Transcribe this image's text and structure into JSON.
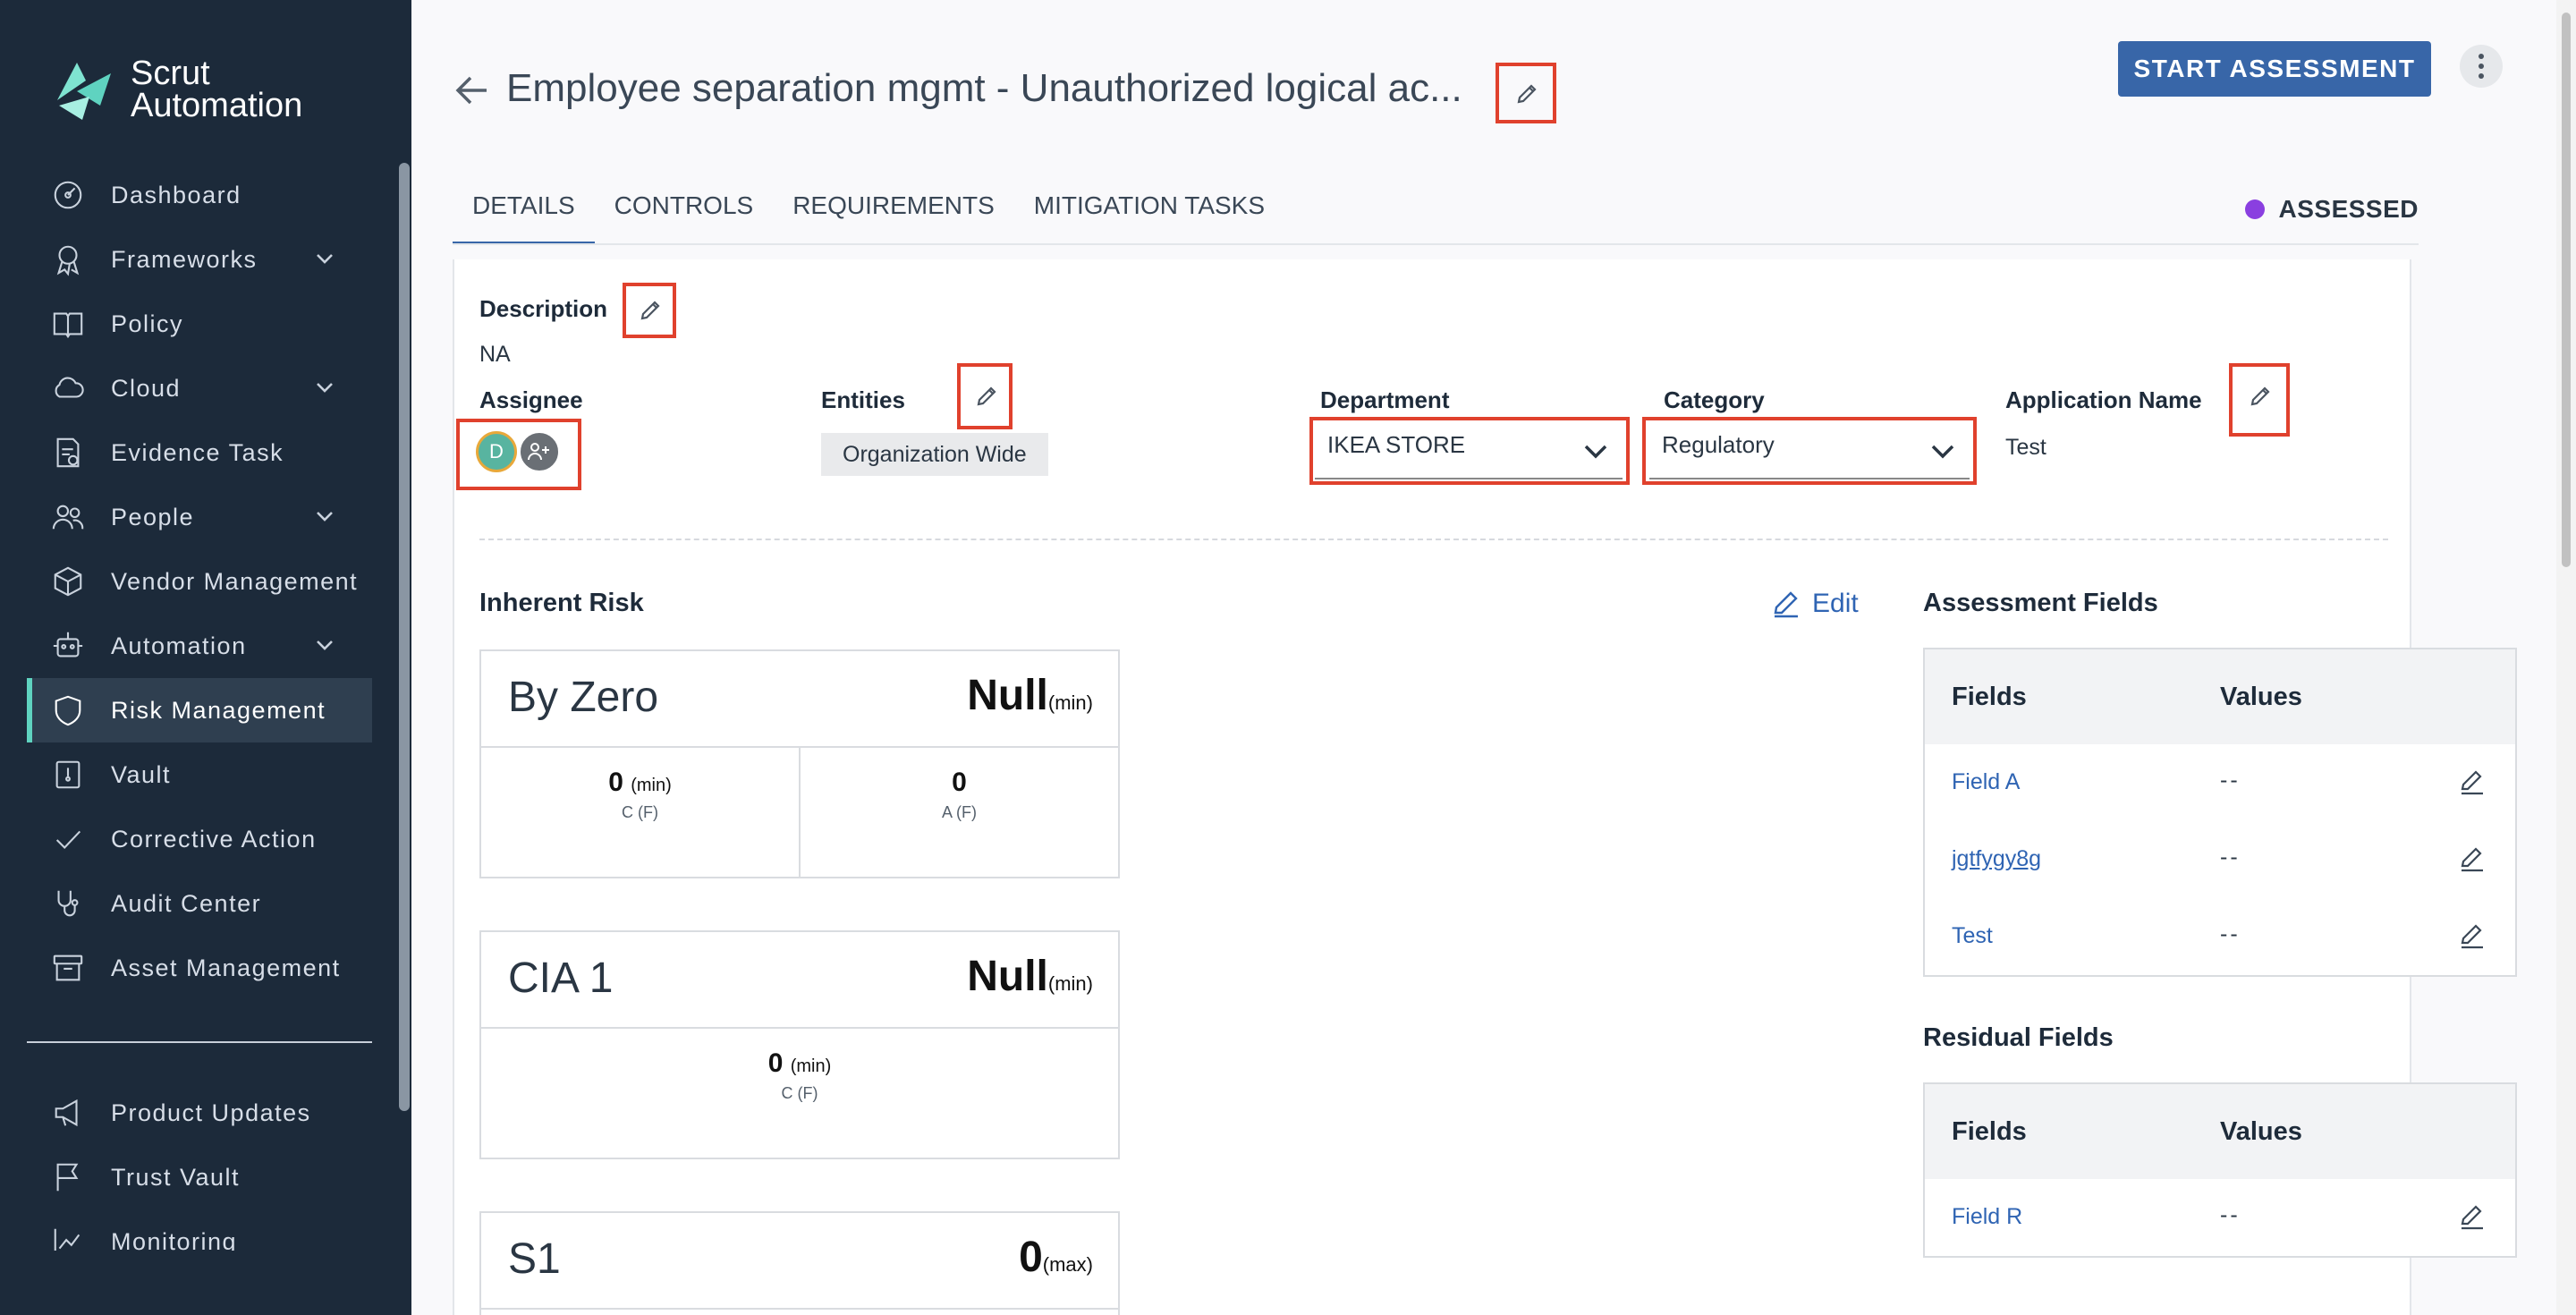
{
  "brand": {
    "line1": "Scrut",
    "line2": "Automation",
    "accent": "#5fd3c0"
  },
  "sidebar": {
    "items": [
      {
        "label": "Dashboard",
        "icon": "dashboard-icon",
        "expandable": false
      },
      {
        "label": "Frameworks",
        "icon": "award-icon",
        "expandable": true
      },
      {
        "label": "Policy",
        "icon": "book-icon",
        "expandable": false
      },
      {
        "label": "Cloud",
        "icon": "cloud-icon",
        "expandable": true
      },
      {
        "label": "Evidence Task",
        "icon": "evidence-icon",
        "expandable": false
      },
      {
        "label": "People",
        "icon": "people-icon",
        "expandable": true
      },
      {
        "label": "Vendor Management",
        "icon": "box-icon",
        "expandable": false
      },
      {
        "label": "Automation",
        "icon": "robot-icon",
        "expandable": true
      },
      {
        "label": "Risk Management",
        "icon": "shield-icon",
        "expandable": false,
        "active": true
      },
      {
        "label": "Vault",
        "icon": "vault-icon",
        "expandable": false
      },
      {
        "label": "Corrective Action",
        "icon": "check-icon",
        "expandable": false
      },
      {
        "label": "Audit Center",
        "icon": "stethoscope-icon",
        "expandable": false
      },
      {
        "label": "Asset Management",
        "icon": "archive-icon",
        "expandable": false
      }
    ],
    "bottom_items": [
      {
        "label": "Product Updates",
        "icon": "megaphone-icon"
      },
      {
        "label": "Trust Vault",
        "icon": "flag-icon"
      },
      {
        "label": "Monitoring",
        "icon": "chart-icon"
      }
    ]
  },
  "header": {
    "title": "Employee separation mgmt - Unauthorized logical ac...",
    "start_label": "START ASSESSMENT",
    "start_color": "#3866a8"
  },
  "tabs": [
    {
      "label": "DETAILS",
      "active": true
    },
    {
      "label": "CONTROLS"
    },
    {
      "label": "REQUIREMENTS"
    },
    {
      "label": "MITIGATION TASKS"
    }
  ],
  "status": {
    "label": "ASSESSED",
    "color": "#8a3fe0"
  },
  "details": {
    "description_label": "Description",
    "description_value": "NA",
    "assignee_label": "Assignee",
    "assignee_initial": "D",
    "entities_label": "Entities",
    "entities_chip": "Organization Wide",
    "department_label": "Department",
    "department_value": "IKEA STORE",
    "category_label": "Category",
    "category_value": "Regulatory",
    "appname_label": "Application Name",
    "appname_value": "Test"
  },
  "inherent": {
    "title": "Inherent Risk",
    "edit_label": "Edit",
    "boxes": [
      {
        "name": "By Zero",
        "score": "Null",
        "score_unit": "(min)",
        "cells": [
          {
            "value": "0",
            "unit": "(min)",
            "label": "C (F)"
          },
          {
            "value": "0",
            "unit": "",
            "label": "A (F)"
          }
        ]
      },
      {
        "name": "CIA 1",
        "score": "Null",
        "score_unit": "(min)",
        "cells": [
          {
            "value": "0",
            "unit": "(min)",
            "label": "C (F)"
          }
        ]
      },
      {
        "name": "S1",
        "score": "0",
        "score_unit": "(max)",
        "cells": []
      }
    ]
  },
  "assessment": {
    "title": "Assessment Fields",
    "col_fields": "Fields",
    "col_values": "Values",
    "rows": [
      {
        "field": "Field A",
        "value": "--"
      },
      {
        "field": "jgtfygy8g",
        "value": "--"
      },
      {
        "field": "Test",
        "value": "--"
      }
    ]
  },
  "residual": {
    "title": "Residual Fields",
    "col_fields": "Fields",
    "col_values": "Values",
    "rows": [
      {
        "field": "Field R",
        "value": "--"
      }
    ]
  }
}
